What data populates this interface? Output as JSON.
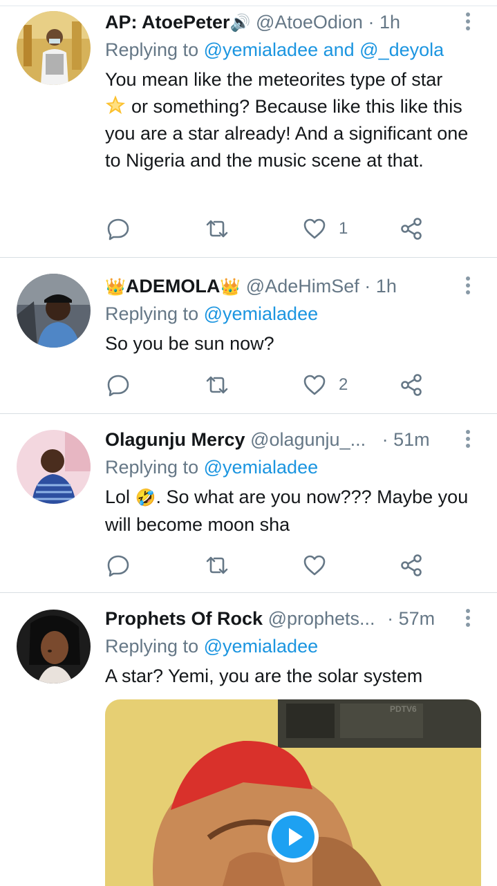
{
  "tweets": [
    {
      "name": "AP: AtoePeter",
      "name_emoji": "🔊",
      "handle": "@AtoeOdion",
      "separator": "·",
      "time": "1h",
      "replying_prefix": "Replying to",
      "replying_to": "@yemialadee and @_deyola",
      "text_line1": "You mean like the meteorites type of star",
      "text_rest": "or something? Because like this like this you are a star already! And a significant one to Nigeria and the music scene at that.",
      "likes": "1"
    },
    {
      "name_prefix_emoji": "👑",
      "name": "ADEMOLA",
      "name_suffix_emoji": "👑",
      "handle": "@AdeHimSef",
      "separator": "·",
      "time": "1h",
      "replying_prefix": "Replying to",
      "replying_to": "@yemialadee",
      "text": "So you be sun now?",
      "likes": "2"
    },
    {
      "name": "Olagunju Mercy",
      "handle": "@olagunju_...",
      "separator": "·",
      "time": "51m",
      "replying_prefix": "Replying to",
      "replying_to": "@yemialadee",
      "text_before_emoji": "Lol",
      "text_emoji": "🤣",
      "text_after_emoji": ". So what are you now???  Maybe you will become moon sha",
      "likes": ""
    },
    {
      "name": "Prophets Of Rock",
      "handle": "@prophets...",
      "separator": "·",
      "time": "57m",
      "replying_prefix": "Replying to",
      "replying_to": "@yemialadee",
      "text": "A star? Yemi, you are the solar system",
      "media_watermark": "PDTV6"
    }
  ],
  "icons": {
    "reply": "reply-icon",
    "retweet": "retweet-icon",
    "like": "heart-icon",
    "share": "share-icon",
    "more": "more-vertical-icon",
    "play": "play-icon"
  },
  "colors": {
    "mention": "#1b95e0",
    "secondary_text": "#657786",
    "play_button": "#1da1f2"
  }
}
